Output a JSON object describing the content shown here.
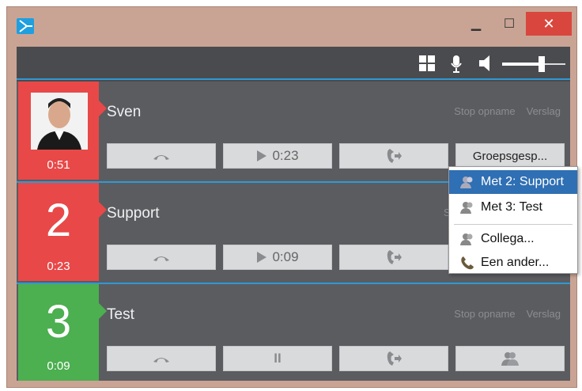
{
  "window": {
    "close_glyph": "✕",
    "minimize_glyph": "▁",
    "maximize_glyph": "☐"
  },
  "toolbar": {
    "volume_level": 0.6
  },
  "calls": [
    {
      "name": "Sven",
      "number": "",
      "time": "0:51",
      "color": "#e84848",
      "has_photo": true,
      "links": [
        "Stop opname",
        "Verslag"
      ],
      "buttons": {
        "hangup": "",
        "play": "0:23",
        "transfer": "",
        "group": "Groepsgesp..."
      }
    },
    {
      "name": "Support",
      "number": "2",
      "time": "0:23",
      "color": "#e84848",
      "has_photo": false,
      "links": [
        "Sto"
      ],
      "buttons": {
        "hangup": "",
        "play": "0:09",
        "transfer": ""
      }
    },
    {
      "name": "Test",
      "number": "3",
      "time": "0:09",
      "color": "#4caf50",
      "has_photo": false,
      "links": [
        "Stop opname",
        "Verslag"
      ],
      "buttons": {
        "hangup": "",
        "pause": "II",
        "transfer": "",
        "group": ""
      }
    }
  ],
  "context_menu": {
    "items": [
      {
        "label": "Met 2: Support",
        "selected": true,
        "icon": "group-icon"
      },
      {
        "label": "Met 3: Test",
        "selected": false,
        "icon": "group-icon"
      },
      {
        "label": "Collega...",
        "selected": false,
        "icon": "group-icon"
      },
      {
        "label": "Een ander...",
        "selected": false,
        "icon": "phone-icon"
      }
    ]
  }
}
